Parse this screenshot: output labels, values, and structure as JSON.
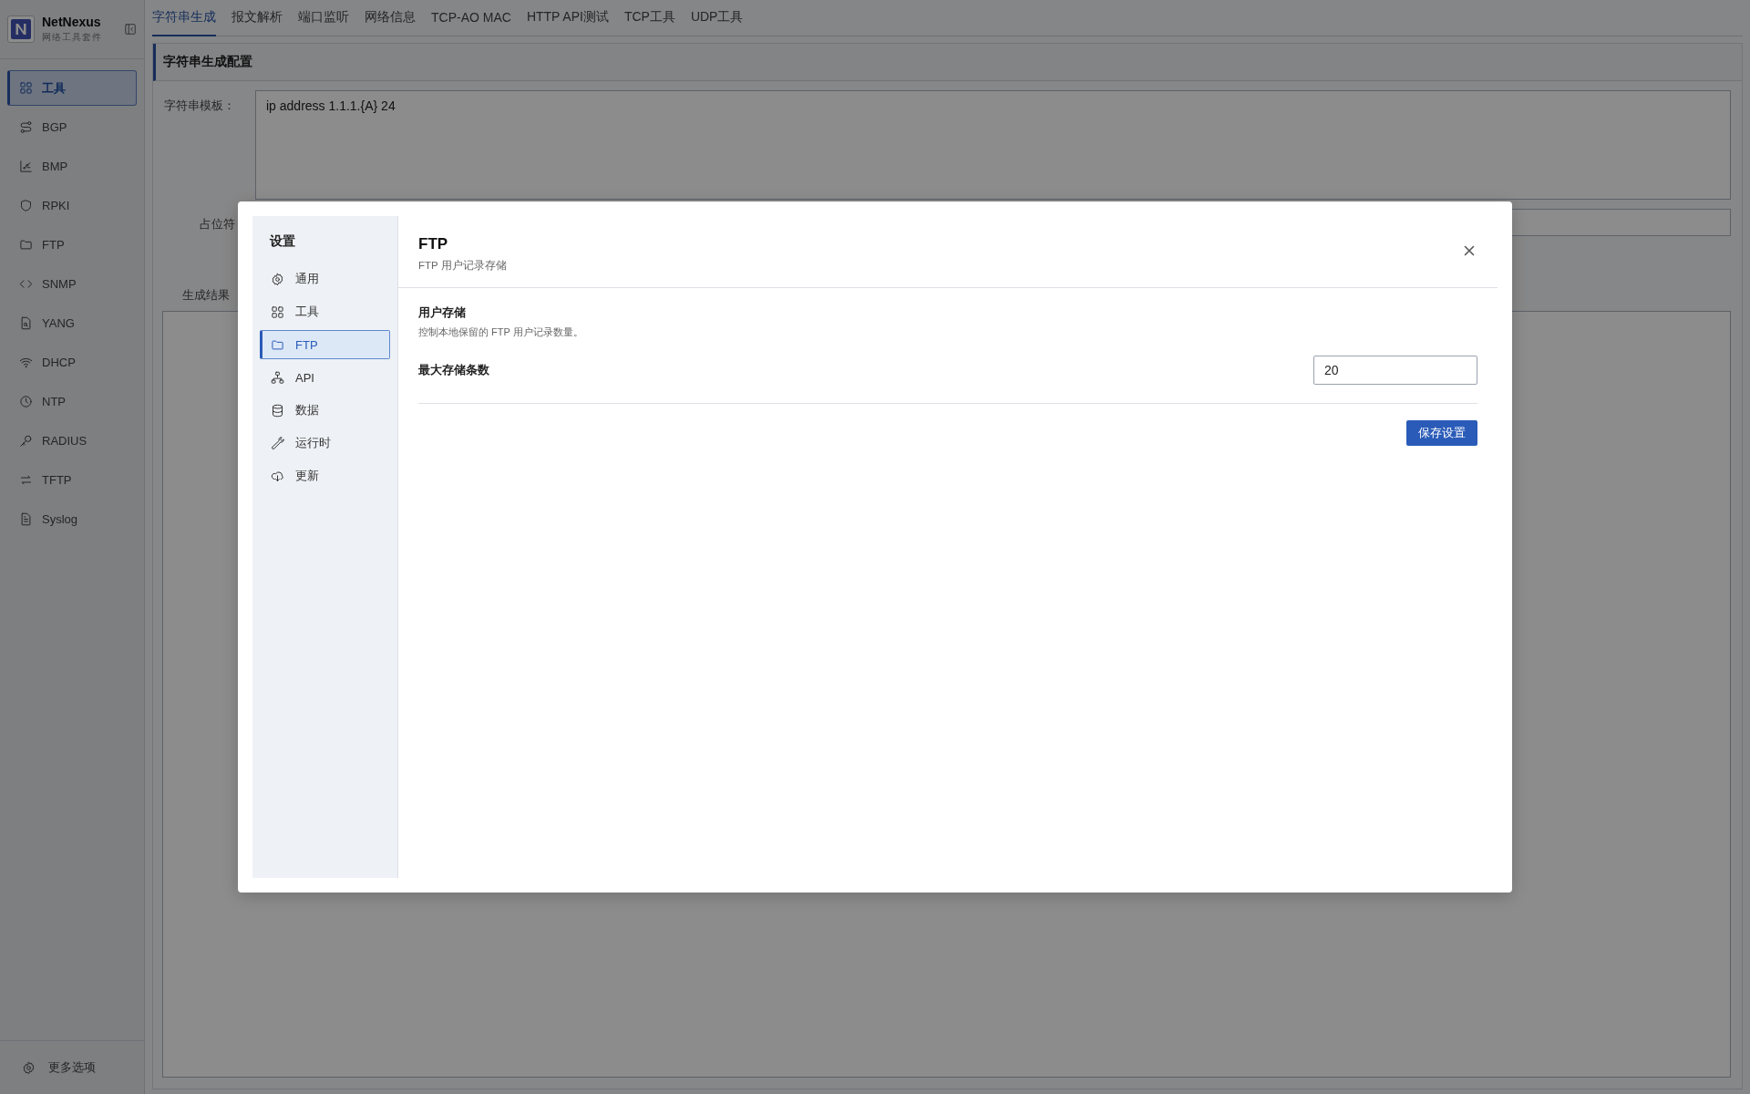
{
  "app": {
    "name": "NetNexus",
    "subtitle": "网络工具套件"
  },
  "sidebar": {
    "items": [
      {
        "label": "工具",
        "selected": true
      },
      {
        "label": "BGP",
        "selected": false
      },
      {
        "label": "BMP",
        "selected": false
      },
      {
        "label": "RPKI",
        "selected": false
      },
      {
        "label": "FTP",
        "selected": false
      },
      {
        "label": "SNMP",
        "selected": false
      },
      {
        "label": "YANG",
        "selected": false
      },
      {
        "label": "DHCP",
        "selected": false
      },
      {
        "label": "NTP",
        "selected": false
      },
      {
        "label": "RADIUS",
        "selected": false
      },
      {
        "label": "TFTP",
        "selected": false
      },
      {
        "label": "Syslog",
        "selected": false
      }
    ],
    "footer": "更多选项"
  },
  "tabs": [
    {
      "label": "字符串生成",
      "selected": true
    },
    {
      "label": "报文解析",
      "selected": false
    },
    {
      "label": "端口监听",
      "selected": false
    },
    {
      "label": "网络信息",
      "selected": false
    },
    {
      "label": "TCP-AO MAC",
      "selected": false
    },
    {
      "label": "HTTP API测试",
      "selected": false
    },
    {
      "label": "TCP工具",
      "selected": false
    },
    {
      "label": "UDP工具",
      "selected": false
    }
  ],
  "panel": {
    "title": "字符串生成配置",
    "fields": [
      {
        "kind": "textarea",
        "label": "字符串模板：",
        "value": "ip address 1.1.1.{A} 24"
      },
      {
        "kind": "input",
        "label": "占位符"
      },
      {
        "kind": "output",
        "label": "生成结果"
      }
    ]
  },
  "dialog": {
    "nav_title": "设置",
    "nav": [
      {
        "label": "通用",
        "selected": false
      },
      {
        "label": "工具",
        "selected": false
      },
      {
        "label": "FTP",
        "selected": true
      },
      {
        "label": "API",
        "selected": false
      },
      {
        "label": "数据",
        "selected": false
      },
      {
        "label": "运行时",
        "selected": false
      },
      {
        "label": "更新",
        "selected": false
      }
    ],
    "title": "FTP",
    "subtitle": "FTP 用户记录存储",
    "section": {
      "title": "用户存储",
      "description": "控制本地保留的 FTP 用户记录数量。"
    },
    "fields": [
      {
        "label": "最大存储条数",
        "value": "20"
      }
    ],
    "save_button": "保存设置"
  }
}
